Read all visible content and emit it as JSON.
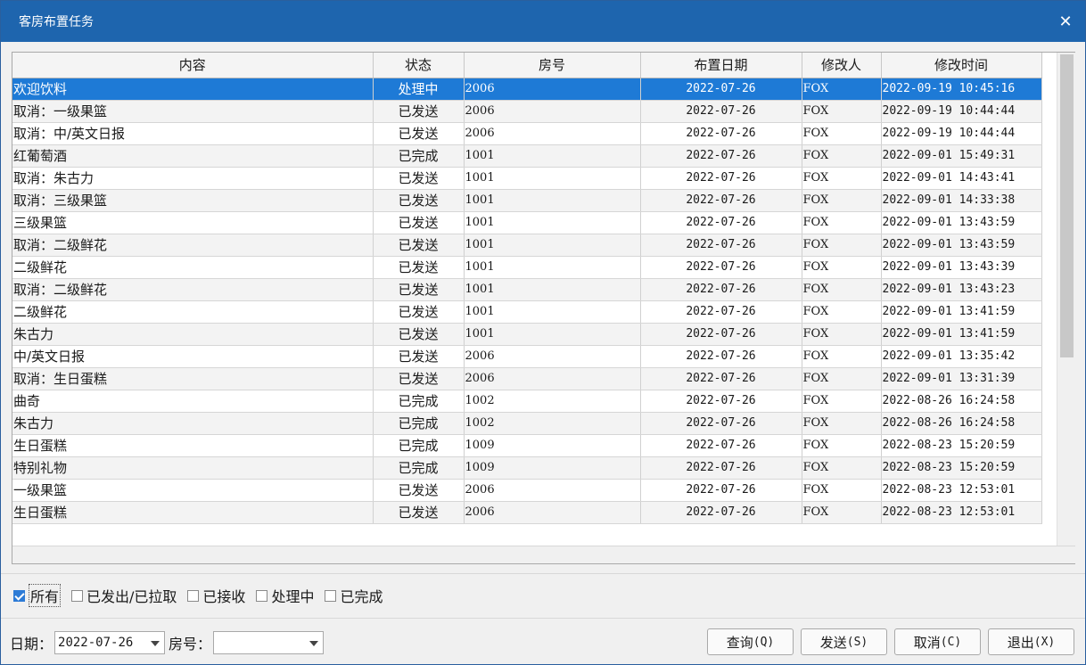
{
  "window": {
    "title": "客房布置任务"
  },
  "grid": {
    "columns": [
      "内容",
      "状态",
      "房号",
      "布置日期",
      "修改人",
      "修改时间"
    ],
    "rows": [
      {
        "content": "欢迎饮料",
        "status": "处理中",
        "room": "2006",
        "date": "2022-07-26",
        "user": "FOX",
        "time": "2022-09-19 10:45:16"
      },
      {
        "content": "取消：一级果篮",
        "status": "已发送",
        "room": "2006",
        "date": "2022-07-26",
        "user": "FOX",
        "time": "2022-09-19 10:44:44"
      },
      {
        "content": "取消：中/英文日报",
        "status": "已发送",
        "room": "2006",
        "date": "2022-07-26",
        "user": "FOX",
        "time": "2022-09-19 10:44:44"
      },
      {
        "content": "红葡萄酒",
        "status": "已完成",
        "room": "1001",
        "date": "2022-07-26",
        "user": "FOX",
        "time": "2022-09-01 15:49:31"
      },
      {
        "content": "取消：朱古力",
        "status": "已发送",
        "room": "1001",
        "date": "2022-07-26",
        "user": "FOX",
        "time": "2022-09-01 14:43:41"
      },
      {
        "content": "取消：三级果篮",
        "status": "已发送",
        "room": "1001",
        "date": "2022-07-26",
        "user": "FOX",
        "time": "2022-09-01 14:33:38"
      },
      {
        "content": "三级果篮",
        "status": "已发送",
        "room": "1001",
        "date": "2022-07-26",
        "user": "FOX",
        "time": "2022-09-01 13:43:59"
      },
      {
        "content": "取消：二级鲜花",
        "status": "已发送",
        "room": "1001",
        "date": "2022-07-26",
        "user": "FOX",
        "time": "2022-09-01 13:43:59"
      },
      {
        "content": "二级鲜花",
        "status": "已发送",
        "room": "1001",
        "date": "2022-07-26",
        "user": "FOX",
        "time": "2022-09-01 13:43:39"
      },
      {
        "content": "取消：二级鲜花",
        "status": "已发送",
        "room": "1001",
        "date": "2022-07-26",
        "user": "FOX",
        "time": "2022-09-01 13:43:23"
      },
      {
        "content": "二级鲜花",
        "status": "已发送",
        "room": "1001",
        "date": "2022-07-26",
        "user": "FOX",
        "time": "2022-09-01 13:41:59"
      },
      {
        "content": "朱古力",
        "status": "已发送",
        "room": "1001",
        "date": "2022-07-26",
        "user": "FOX",
        "time": "2022-09-01 13:41:59"
      },
      {
        "content": "中/英文日报",
        "status": "已发送",
        "room": "2006",
        "date": "2022-07-26",
        "user": "FOX",
        "time": "2022-09-01 13:35:42"
      },
      {
        "content": "取消：生日蛋糕",
        "status": "已发送",
        "room": "2006",
        "date": "2022-07-26",
        "user": "FOX",
        "time": "2022-09-01 13:31:39"
      },
      {
        "content": "曲奇",
        "status": "已完成",
        "room": "1002",
        "date": "2022-07-26",
        "user": "FOX",
        "time": "2022-08-26 16:24:58"
      },
      {
        "content": "朱古力",
        "status": "已完成",
        "room": "1002",
        "date": "2022-07-26",
        "user": "FOX",
        "time": "2022-08-26 16:24:58"
      },
      {
        "content": "生日蛋糕",
        "status": "已完成",
        "room": "1009",
        "date": "2022-07-26",
        "user": "FOX",
        "time": "2022-08-23 15:20:59"
      },
      {
        "content": "特别礼物",
        "status": "已完成",
        "room": "1009",
        "date": "2022-07-26",
        "user": "FOX",
        "time": "2022-08-23 15:20:59"
      },
      {
        "content": "一级果篮",
        "status": "已发送",
        "room": "2006",
        "date": "2022-07-26",
        "user": "FOX",
        "time": "2022-08-23 12:53:01"
      },
      {
        "content": "生日蛋糕",
        "status": "已发送",
        "room": "2006",
        "date": "2022-07-26",
        "user": "FOX",
        "time": "2022-08-23 12:53:01"
      }
    ]
  },
  "filters": [
    {
      "label": "所有",
      "checked": true
    },
    {
      "label": "已发出/已拉取",
      "checked": false
    },
    {
      "label": "已接收",
      "checked": false
    },
    {
      "label": "处理中",
      "checked": false
    },
    {
      "label": "已完成",
      "checked": false
    }
  ],
  "bottom": {
    "date_label": "日期：",
    "date_value": "2022-07-26",
    "room_label": "房号：",
    "room_value": ""
  },
  "buttons": [
    {
      "label": "查询",
      "key": "(Q)"
    },
    {
      "label": "发送",
      "key": "(S)"
    },
    {
      "label": "取消",
      "key": "(C)"
    },
    {
      "label": "退出",
      "key": "(X)"
    }
  ],
  "icons": {
    "close": "close-icon"
  }
}
